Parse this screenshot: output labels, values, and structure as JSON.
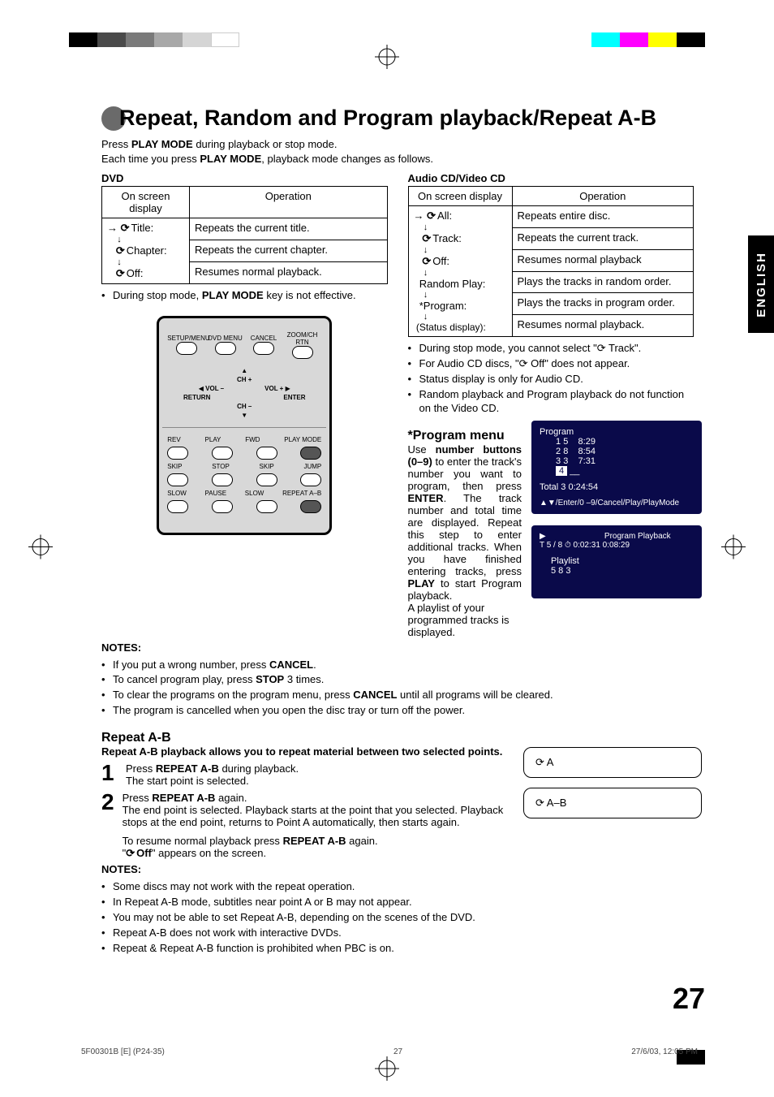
{
  "title": "Repeat, Random and Program playback/Repeat A-B",
  "intro1_a": "Press ",
  "intro1_b": "PLAY MODE",
  "intro1_c": " during playback or stop mode.",
  "intro2_a": "Each time you press ",
  "intro2_b": "PLAY MODE",
  "intro2_c": ", playback mode changes as follows.",
  "dvd": {
    "heading": "DVD",
    "th1": "On screen display",
    "th2": "Operation",
    "rows": [
      {
        "label": "Title:",
        "op": "Repeats the current title."
      },
      {
        "label": "Chapter:",
        "op": "Repeats the current chapter."
      },
      {
        "label": "Off:",
        "op": "Resumes normal playback."
      }
    ],
    "note": "During stop mode, PLAY MODE key is not effective.",
    "note_a": "During stop mode, ",
    "note_b": "PLAY MODE",
    "note_c": " key is not effective."
  },
  "cd": {
    "heading": "Audio CD/Video CD",
    "th1": "On screen display",
    "th2": "Operation",
    "rows": [
      {
        "label": "All:",
        "op": "Repeats entire disc.",
        "sym": true
      },
      {
        "label": "Track:",
        "op": "Repeats the current track.",
        "sym": true
      },
      {
        "label": "Off:",
        "op": "Resumes normal playback",
        "sym": true
      },
      {
        "label": "Random Play:",
        "op": "Plays the tracks in random order.",
        "sym": false
      },
      {
        "label": "*Program:",
        "op": "Plays the tracks in program order.",
        "sym": false
      },
      {
        "label": "(Status display):",
        "op": "Resumes normal playback.",
        "sym": false
      }
    ],
    "notes": [
      "During stop mode, you cannot select \"⟳ Track\".",
      "For Audio CD discs, \"⟳ Off\" does not appear.",
      "Status display is only for Audio CD.",
      "Random playback and Program playback do not function on the Video CD."
    ]
  },
  "remote": {
    "top": [
      "SETUP/MENU",
      "DVD MENU",
      "CANCEL",
      "ZOOM/CH RTN"
    ],
    "ch_up": "CH +",
    "ch_dn": "CH –",
    "vol_l": "VOL –",
    "vol_r": "VOL +",
    "return": "RETURN",
    "enter": "ENTER",
    "row1": [
      "REV",
      "PLAY",
      "FWD",
      "PLAY MODE"
    ],
    "row2": [
      "SKIP",
      "STOP",
      "SKIP",
      "JUMP"
    ],
    "row3": [
      "SLOW",
      "PAUSE",
      "SLOW",
      "REPEAT A–B"
    ]
  },
  "notes_head": "NOTES:",
  "notes1": [
    "If you put a wrong number, press CANCEL.",
    "To cancel program play, press STOP 3 times.",
    "To clear the programs on the program menu, press CANCEL until all programs will be cleared.",
    "The program is cancelled when you open the disc tray or turn off the power."
  ],
  "program": {
    "heading": "*Program menu",
    "body": "Use number buttons (0–9) to enter the track's number you want to program, then press ENTER. The track number and total time are displayed. Repeat this step to enter additional tracks. When you have finished entering tracks, press PLAY to start Program playback.",
    "body2": "A playlist of your programmed tracks is displayed."
  },
  "osd1": {
    "title": "Program",
    "rows": [
      [
        "1",
        "5",
        "8:29"
      ],
      [
        "2",
        "8",
        "8:54"
      ],
      [
        "3",
        "3",
        "7:31"
      ],
      [
        "4",
        "__",
        ""
      ]
    ],
    "total": "Total 3   0:24:54",
    "hint": "▲▼/Enter/0 –9/Cancel/Play/PlayMode"
  },
  "osd2": {
    "top": "▶                          Program Playback",
    "line2": "T 5 / 8   ⏱ 0:02:31   0:08:29",
    "pl": "Playlist",
    "list": "5  8  3"
  },
  "repeatab": {
    "heading": "Repeat A-B",
    "sub": "Repeat A-B playback allows you to repeat material between two selected points.",
    "step1_a": "Press ",
    "step1_b": "REPEAT A-B",
    "step1_c": " during playback.",
    "step1_d": "The start point is selected.",
    "step2_a": "Press ",
    "step2_b": "REPEAT A-B",
    "step2_c": " again.",
    "step2_d": "The end point is selected. Playback starts at the point that you selected. Playback stops at the end point, returns to Point A automatically, then starts again.",
    "resume_a": "To resume normal playback press ",
    "resume_b": "REPEAT A-B",
    "resume_c": " again.",
    "off": "\"⟳ Off\" appears on the screen."
  },
  "notes2": [
    "Some discs may not work with the repeat  operation.",
    "In Repeat A-B mode, subtitles near point A or B may not appear.",
    "You may not be able to set Repeat A-B, depending on the scenes of the DVD.",
    "Repeat A-B does not work with interactive DVDs.",
    "Repeat & Repeat A-B function is prohibited when PBC is on."
  ],
  "ab1": "⟳ A",
  "ab2": "⟳ A–B",
  "side": "ENGLISH",
  "page": "27",
  "foot_left": "5F00301B [E] (P24-35)",
  "foot_mid": "27",
  "foot_right": "27/6/03, 12:05 PM"
}
